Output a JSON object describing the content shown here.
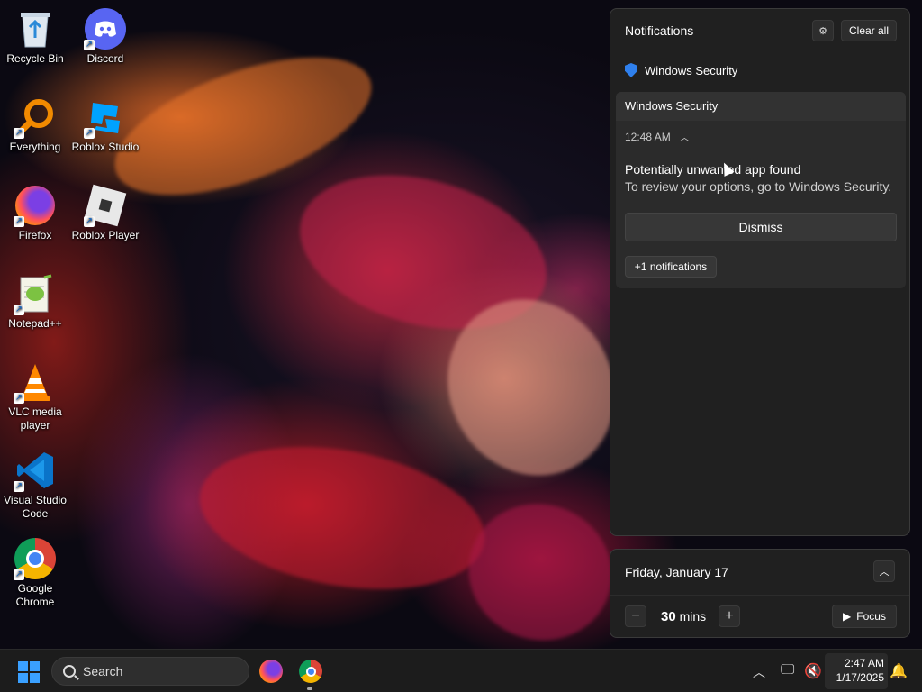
{
  "desktop": {
    "icons": [
      {
        "label": "Recycle Bin"
      },
      {
        "label": "Discord"
      },
      {
        "label": "Everything"
      },
      {
        "label": "Roblox Studio"
      },
      {
        "label": "Firefox"
      },
      {
        "label": "Roblox Player"
      },
      {
        "label": "Notepad++"
      },
      {
        "label": "VLC media player"
      },
      {
        "label": "Visual Studio Code"
      },
      {
        "label": "Google Chrome"
      }
    ]
  },
  "notifications": {
    "title": "Notifications",
    "clear_all": "Clear all",
    "app_name": "Windows Security",
    "card": {
      "header": "Windows Security",
      "time": "12:48 AM",
      "title": "Potentially unwanted app found",
      "body": "To review your options, go to Windows Security.",
      "dismiss": "Dismiss",
      "more": "+1 notifications"
    }
  },
  "calendar": {
    "date": "Friday, January 17",
    "focus_value": "30",
    "focus_unit": "mins",
    "focus_button": "Focus"
  },
  "taskbar": {
    "search_label": "Search",
    "time": "2:47 AM",
    "date": "1/17/2025"
  },
  "colors": {
    "accent": "#3aa0ff",
    "panel_bg": "#202020",
    "shield": "#2f80ed"
  }
}
